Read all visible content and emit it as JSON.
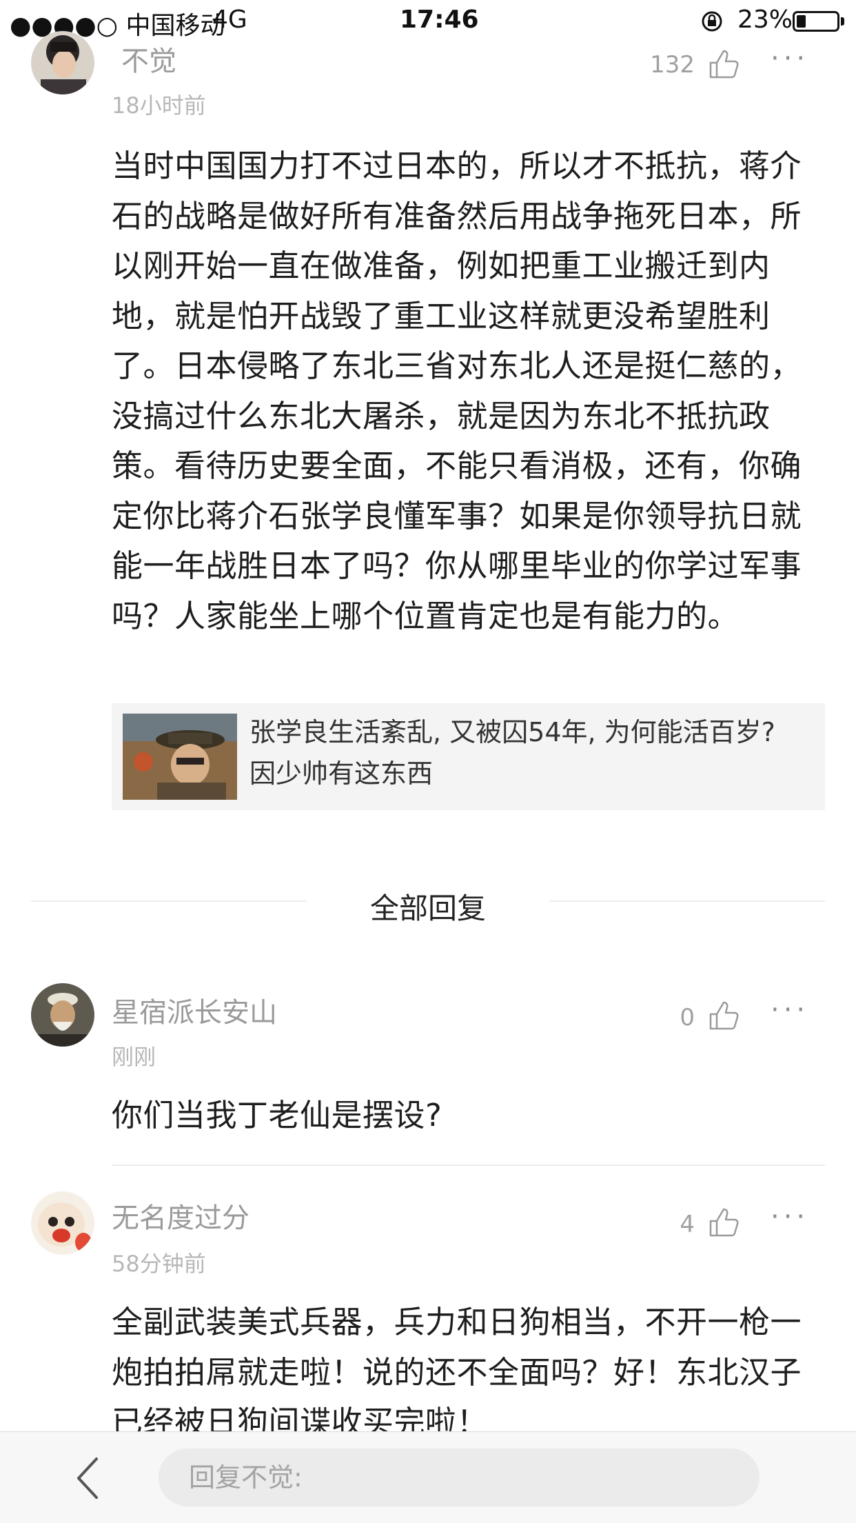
{
  "status_bar": {
    "carrier": "●●●●○ 中国移动",
    "network": "4G",
    "time": "17:46",
    "battery": "23%",
    "battery_level": 0.23
  },
  "main_comment": {
    "author": "不觉",
    "time": "18小时前",
    "likes": "132",
    "more": "···",
    "text": "当时中国国力打不过日本的，所以才不抵抗，蒋介石的战略是做好所有准备然后用战争拖死日本，所以刚开始一直在做准备，例如把重工业搬迁到内地，就是怕开战毁了重工业这样就更没希望胜利了。日本侵略了东北三省对东北人还是挺仁慈的，没搞过什么东北大屠杀，就是因为东北不抵抗政策。看待历史要全面，不能只看消极，还有，你确定你比蒋介石张学良懂军事？如果是你领导抗日就能一年战胜日本了吗？你从哪里毕业的你学过军事吗？人家能坐上哪个位置肯定也是有能力的。",
    "article": {
      "title": "张学良生活紊乱, 又被囚54年, 为何能活百岁? 因少帅有这东西"
    }
  },
  "replies_section": {
    "title": "全部回复"
  },
  "replies": [
    {
      "author": "星宿派长安山",
      "time": "刚刚",
      "likes": "0",
      "more": "···",
      "text": "你们当我丁老仙是摆设?"
    },
    {
      "author": "无名度过分",
      "time": "58分钟前",
      "likes": "4",
      "more": "···",
      "text": "全副武装美式兵器，兵力和日狗相当，不开一枪一炮拍拍屌就走啦！说的还不全面吗？好！东北汉子已经被日狗间谍收买完啦！"
    }
  ],
  "bottom_bar": {
    "reply_placeholder": "回复不觉:"
  }
}
